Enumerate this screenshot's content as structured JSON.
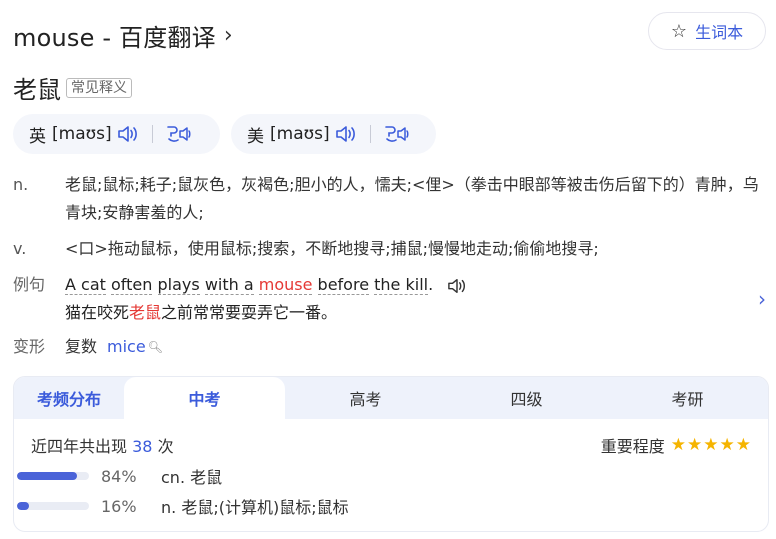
{
  "header": {
    "title": "mouse - 百度翻译",
    "vocab_label": "生词本"
  },
  "headword": {
    "word": "老鼠",
    "tag": "常见释义"
  },
  "pronunciations": [
    {
      "region": "英",
      "ipa": "[maʊs]"
    },
    {
      "region": "美",
      "ipa": "[maʊs]"
    }
  ],
  "definitions": [
    {
      "pos": "n.",
      "text": "老鼠;鼠标;耗子;鼠灰色，灰褐色;胆小的人，懦夫;<俚>（拳击中眼部等被击伤后留下的）青肿，乌青块;安静害羞的人;"
    },
    {
      "pos": "v.",
      "text": "<口>拖动鼠标，使用鼠标;搜索，不断地搜寻;捕鼠;慢慢地走动;偷偷地搜寻;"
    }
  ],
  "example": {
    "label": "例句",
    "en_parts": [
      "A cat",
      "often",
      "plays",
      "with a",
      "mouse",
      "before",
      "the kill",
      "."
    ],
    "cn_before": "猫在咬死",
    "cn_highlight": "老鼠",
    "cn_after": "之前常常要耍弄它一番。"
  },
  "forms": {
    "label": "变形",
    "type": "复数",
    "word": "mice"
  },
  "frequency": {
    "title": "考频分布",
    "tabs": [
      "中考",
      "高考",
      "四级",
      "考研"
    ],
    "active_tab": 0,
    "count_prefix": "近四年共出现",
    "count": "38",
    "count_suffix": "次",
    "importance_label": "重要程度",
    "importance_stars": 5,
    "bars": [
      {
        "percent": 84,
        "percent_label": "84%",
        "label": "cn. 老鼠"
      },
      {
        "percent": 16,
        "percent_label": "16%",
        "label": "n. 老鼠;(计算机)鼠标;鼠标"
      }
    ]
  },
  "colors": {
    "accent": "#3b5bdb",
    "highlight": "#e53935",
    "star": "#f5b400"
  },
  "icons": {
    "vocab": "star-outline-icon",
    "speaker": "speaker-icon",
    "follow_read": "follow-read-icon",
    "more": "chevron-right-icon",
    "search": "magnifier-icon"
  }
}
